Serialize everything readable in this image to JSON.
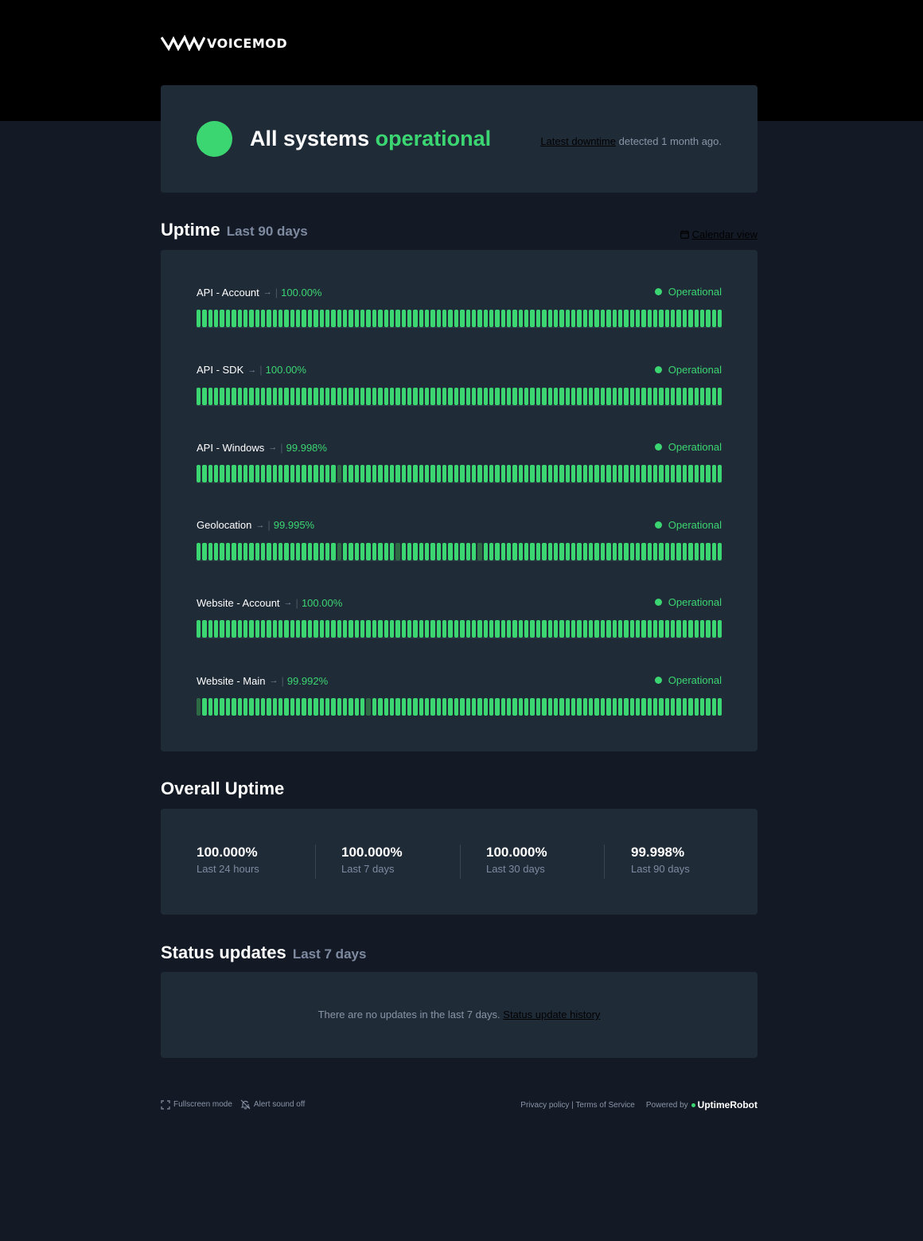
{
  "brand": {
    "logo_text": "VOICEMOD"
  },
  "hero": {
    "title_prefix": "All systems",
    "title_status": "operational",
    "latest_downtime_link": "Latest downtime",
    "latest_downtime_suffix": "detected 1 month ago."
  },
  "uptime_section": {
    "title": "Uptime",
    "subtitle": "Last 90 days",
    "calendar_link": "Calendar view"
  },
  "monitors": [
    {
      "name": "API - Account",
      "uptime": "100.00%",
      "status": "Operational",
      "degraded_days": []
    },
    {
      "name": "API - SDK",
      "uptime": "100.00%",
      "status": "Operational",
      "degraded_days": []
    },
    {
      "name": "API - Windows",
      "uptime": "99.998%",
      "status": "Operational",
      "degraded_days": [
        24
      ]
    },
    {
      "name": "Geolocation",
      "uptime": "99.995%",
      "status": "Operational",
      "degraded_days": [
        24,
        34,
        48
      ]
    },
    {
      "name": "Website - Account",
      "uptime": "100.00%",
      "status": "Operational",
      "degraded_days": []
    },
    {
      "name": "Website - Main",
      "uptime": "99.992%",
      "status": "Operational",
      "degraded_days": [
        0,
        29
      ]
    }
  ],
  "bar_count": 90,
  "overall": {
    "title": "Overall Uptime",
    "stats": [
      {
        "value": "100.000%",
        "label": "Last 24 hours"
      },
      {
        "value": "100.000%",
        "label": "Last 7 days"
      },
      {
        "value": "100.000%",
        "label": "Last 30 days"
      },
      {
        "value": "99.998%",
        "label": "Last 90 days"
      }
    ]
  },
  "updates": {
    "title": "Status updates",
    "subtitle": "Last 7 days",
    "empty_text": "There are no updates in the last 7 days.",
    "history_link": "Status update history"
  },
  "footer": {
    "fullscreen": "Fullscreen mode",
    "alert_sound": "Alert sound off",
    "links": "Privacy policy | Terms of Service",
    "powered_by": "Powered by",
    "powered_brand": "UptimeRobot"
  },
  "colors": {
    "operational": "#3bd671",
    "degraded": "#2e6b45",
    "card": "#202b38",
    "background": "#131a26"
  }
}
